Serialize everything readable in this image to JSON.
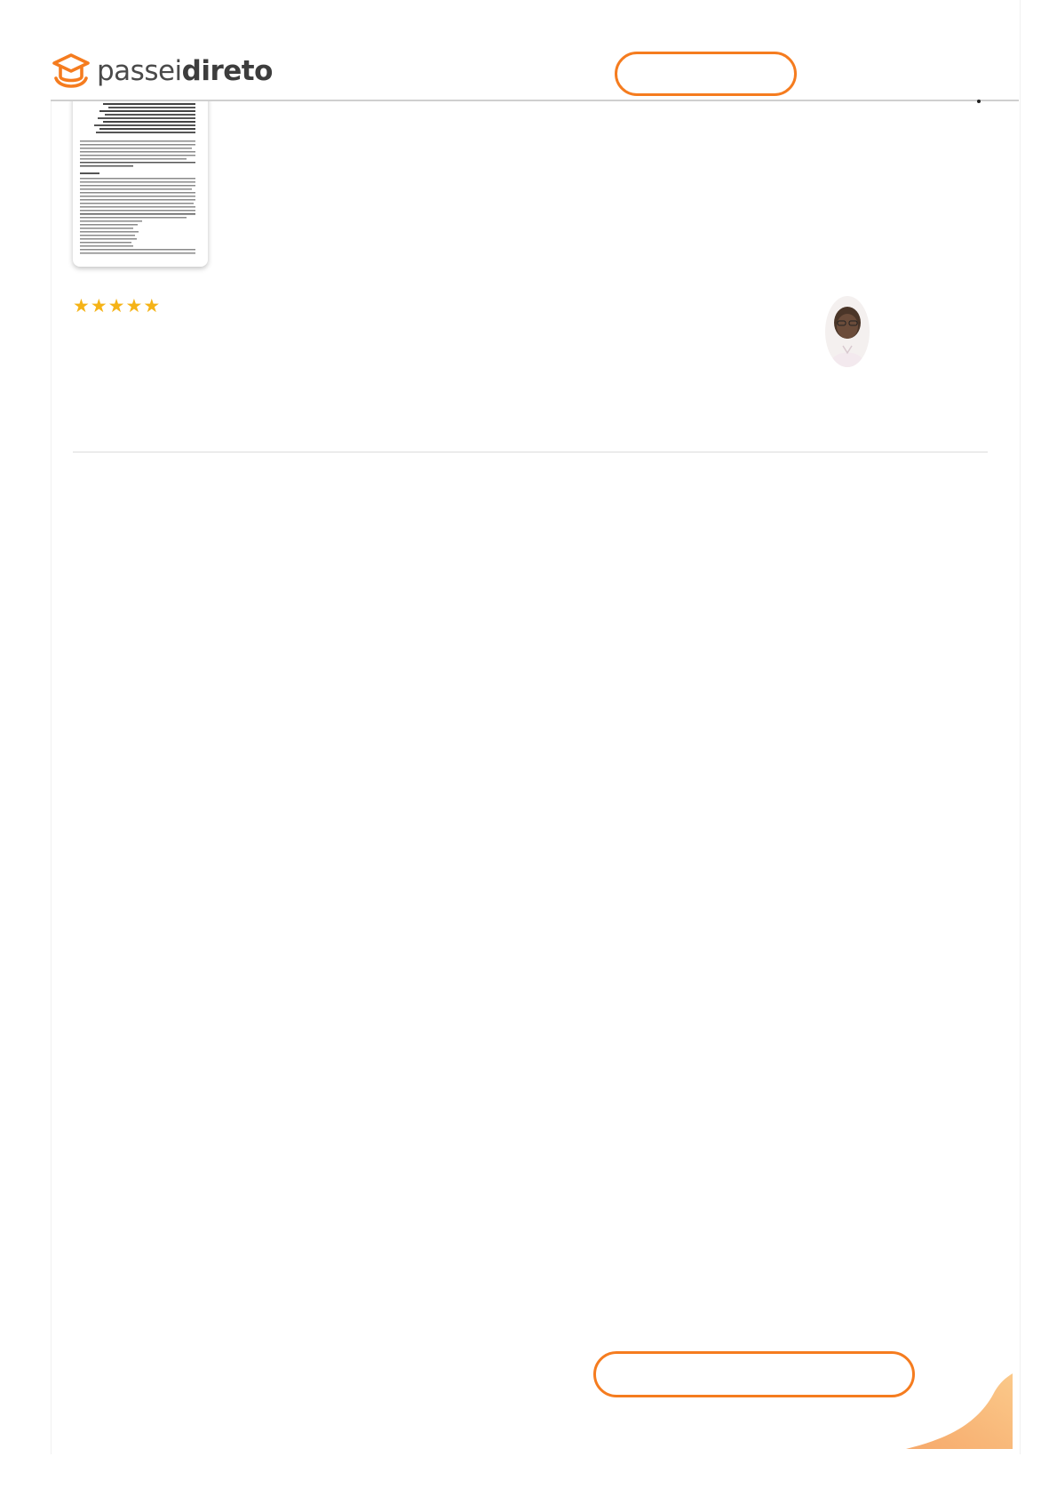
{
  "brand": {
    "name_light": "passei",
    "name_bold": "direto",
    "logo_icon": "graduation-cap-icon",
    "accent_color": "#f57c1f"
  },
  "header": {
    "cta_label": ""
  },
  "document": {
    "thumbnail_icon": "document-page-thumbnail"
  },
  "rating": {
    "stars": 5,
    "max_stars": 5,
    "star_color": "#f5b317"
  },
  "author": {
    "avatar_icon": "user-avatar"
  },
  "footer": {
    "cta_label": ""
  }
}
